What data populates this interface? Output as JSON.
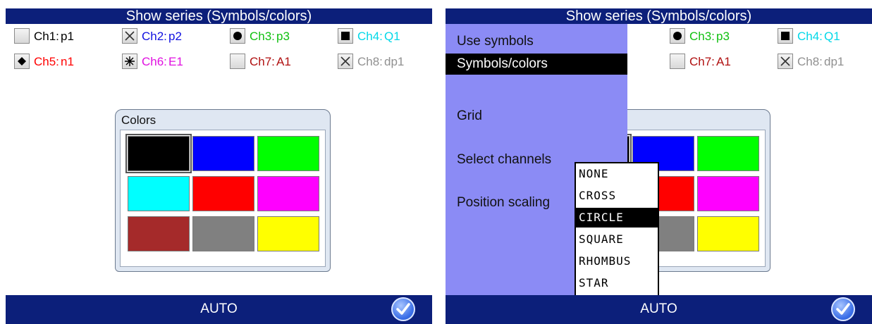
{
  "left": {
    "title": "Show series (Symbols/colors)",
    "channels_row1": [
      {
        "label": "Ch1:",
        "value": "p1",
        "color": "#000000",
        "symbol": "none"
      },
      {
        "label": "Ch2:",
        "value": "p2",
        "color": "#1010e0",
        "symbol": "cross"
      },
      {
        "label": "Ch3:",
        "value": "p3",
        "color": "#10c010",
        "symbol": "circle"
      },
      {
        "label": "Ch4:",
        "value": "Q1",
        "color": "#00d8e8",
        "symbol": "square"
      }
    ],
    "channels_row2": [
      {
        "label": "Ch5:",
        "value": "n1",
        "color": "#ff0000",
        "symbol": "rhombus"
      },
      {
        "label": "Ch6:",
        "value": "E1",
        "color": "#e010e0",
        "symbol": "star"
      },
      {
        "label": "Ch7:",
        "value": "A1",
        "color": "#b01010",
        "symbol": "none"
      },
      {
        "label": "Ch8:",
        "value": "dp1",
        "color": "#909090",
        "symbol": "cross"
      }
    ],
    "dialog_title": "Colors",
    "colors": [
      "#000000",
      "#0000ff",
      "#00ff00",
      "#00ffff",
      "#ff0000",
      "#ff00ff",
      "#a52a2a",
      "#808080",
      "#ffff00"
    ],
    "selected_color_index": 0,
    "bottom_label": "AUTO"
  },
  "right": {
    "title": "Show series (Symbols/colors)",
    "menu_items": [
      "Use symbols",
      "Symbols/colors",
      "Grid",
      "Select channels",
      "Position scaling"
    ],
    "selected_menu_index": 1,
    "symbol_options": [
      "NONE",
      "CROSS",
      "CIRCLE",
      "SQUARE",
      "RHOMBUS",
      "STAR"
    ],
    "selected_symbol_index": 2,
    "bottom_label": "AUTO"
  },
  "ui_colors": {
    "bar": "#0c1f7a",
    "menu": "#8b8bf5"
  }
}
